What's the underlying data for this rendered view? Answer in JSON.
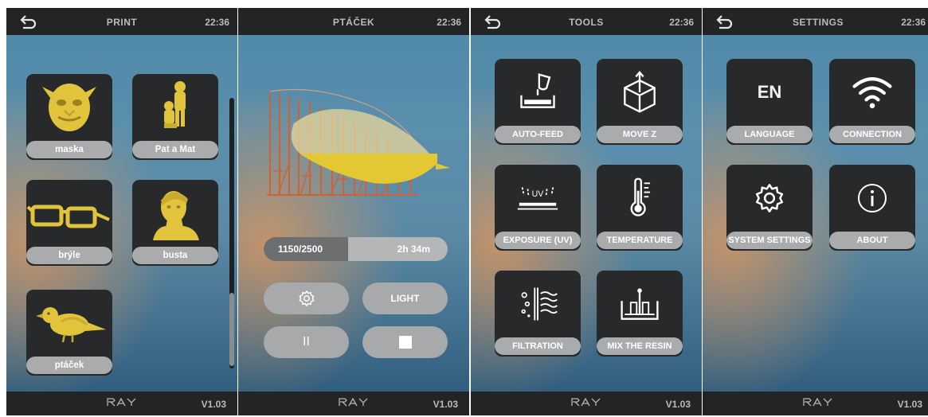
{
  "common": {
    "clock": "22:36",
    "brand": "RAY",
    "version": "V1.03"
  },
  "print_screen": {
    "title": "PRINT",
    "models": [
      {
        "label": "maska"
      },
      {
        "label": "Pat a Mat"
      },
      {
        "label": "brýle"
      },
      {
        "label": "busta"
      },
      {
        "label": "ptáček"
      }
    ]
  },
  "job_screen": {
    "title": "PTÁČEK",
    "layers": "1150/2500",
    "layer_progress": 0.46,
    "remaining": "2h 34m",
    "light_label": "LIGHT",
    "pause_glyph": "II"
  },
  "tools_screen": {
    "title": "TOOLS",
    "tools": [
      {
        "label": "AUTO-FEED",
        "icon": "auto-feed-icon"
      },
      {
        "label": "MOVE Z",
        "icon": "move-z-icon"
      },
      {
        "label": "EXPOSURE (UV)",
        "icon": "uv-exposure-icon"
      },
      {
        "label": "TEMPERATURE",
        "icon": "thermometer-icon"
      },
      {
        "label": "FILTRATION",
        "icon": "filtration-icon"
      },
      {
        "label": "MIX THE RESIN",
        "icon": "mix-resin-icon"
      }
    ]
  },
  "settings_screen": {
    "title": "SETTINGS",
    "items": [
      {
        "label": "LANGUAGE",
        "icon_text": "EN"
      },
      {
        "label": "CONNECTION",
        "icon": "wifi-icon"
      },
      {
        "label": "SYSTEM SETTINGS",
        "icon": "gear-icon"
      },
      {
        "label": "ABOUT",
        "icon": "info-icon"
      }
    ]
  },
  "colors": {
    "model_yellow": "#e8d04a",
    "support_orange": "#c8643a",
    "bar_dark": "#232425",
    "tile_dark": "#27292b",
    "pill_gray": "#a9abad"
  }
}
